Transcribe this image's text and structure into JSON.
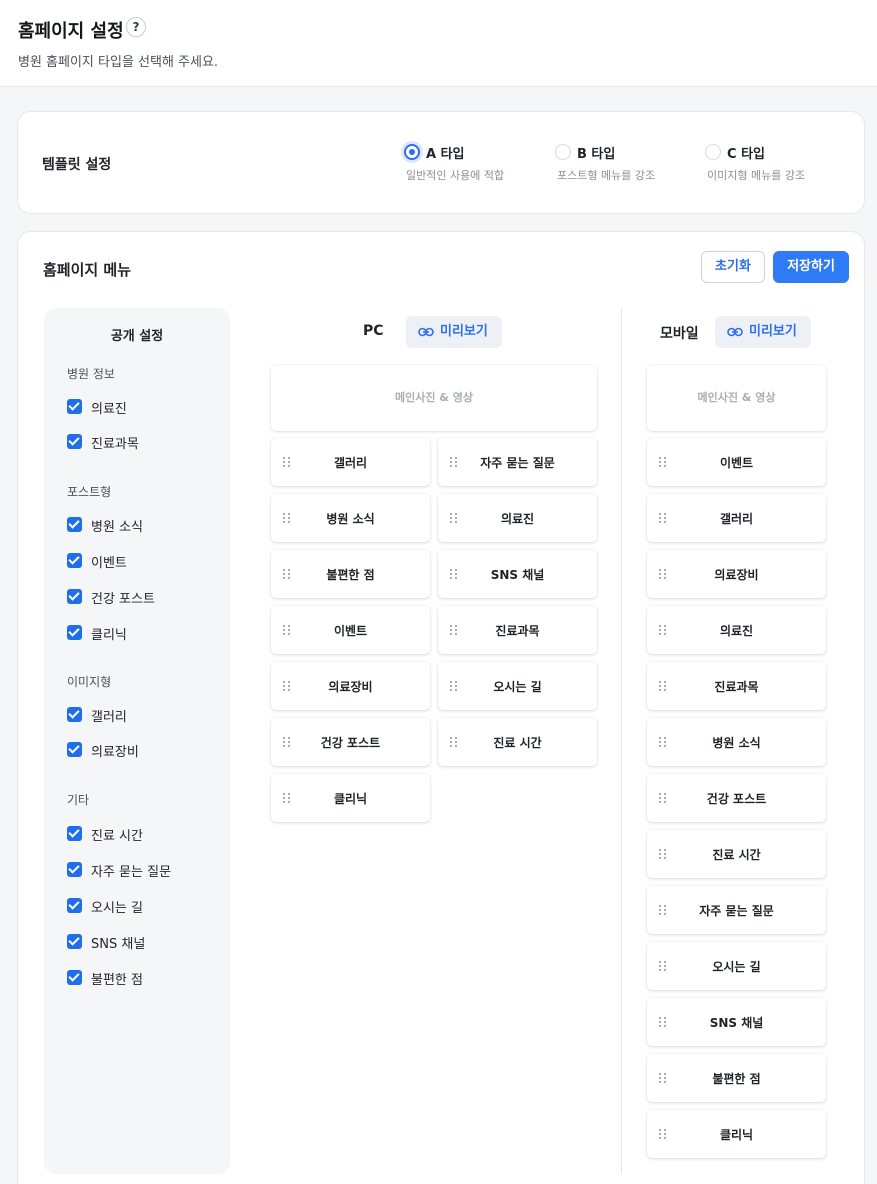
{
  "header": {
    "title": "홈페이지 설정",
    "help_label": "?",
    "subtitle": "병원 홈페이지 타입을 선택해 주세요."
  },
  "template": {
    "label": "템플릿 설정",
    "selected": "A 타입",
    "options": [
      {
        "name": "A 타입",
        "desc": "일반적인 사용에 적합",
        "selected": true
      },
      {
        "name": "B 타입",
        "desc": "포스트형 메뉴를 강조",
        "selected": false
      },
      {
        "name": "C 타입",
        "desc": "이미지형 메뉴를 강조",
        "selected": false
      }
    ]
  },
  "menu": {
    "title": "홈페이지 메뉴",
    "reset_label": "초기화",
    "save_label": "저장하기",
    "accent_color": "#2f7bf5"
  },
  "public": {
    "title": "공개 설정",
    "groups": [
      {
        "title": "병원 정보",
        "items": [
          {
            "label": "의료진",
            "checked": true
          },
          {
            "label": "진료과목",
            "checked": true
          }
        ]
      },
      {
        "title": "포스트형",
        "items": [
          {
            "label": "병원 소식",
            "checked": true
          },
          {
            "label": "이벤트",
            "checked": true
          },
          {
            "label": "건강 포스트",
            "checked": true
          },
          {
            "label": "클리닉",
            "checked": true
          }
        ]
      },
      {
        "title": "이미지형",
        "items": [
          {
            "label": "갤러리",
            "checked": true
          },
          {
            "label": "의료장비",
            "checked": true
          }
        ]
      },
      {
        "title": "기타",
        "items": [
          {
            "label": "진료 시간",
            "checked": true
          },
          {
            "label": "자주 묻는 질문",
            "checked": true
          },
          {
            "label": "오시는 길",
            "checked": true
          },
          {
            "label": "SNS 채널",
            "checked": true
          },
          {
            "label": "불편한 점",
            "checked": true
          }
        ]
      }
    ]
  },
  "pc": {
    "title": "PC",
    "preview_label": "미리보기",
    "banner": "메인사진 & 영상",
    "left_column": [
      "갤러리",
      "병원 소식",
      "불편한 점",
      "이벤트",
      "의료장비",
      "건강 포스트",
      "클리닉"
    ],
    "right_column": [
      "자주 묻는 질문",
      "의료진",
      "SNS 채널",
      "진료과목",
      "오시는 길",
      "진료 시간"
    ]
  },
  "mobile": {
    "title": "모바일",
    "preview_label": "미리보기",
    "banner": "메인사진 & 영상",
    "items": [
      "이벤트",
      "갤러리",
      "의료장비",
      "의료진",
      "진료과목",
      "병원 소식",
      "건강 포스트",
      "진료 시간",
      "자주 묻는 질문",
      "오시는 길",
      "SNS 채널",
      "불편한 점",
      "클리닉"
    ]
  }
}
